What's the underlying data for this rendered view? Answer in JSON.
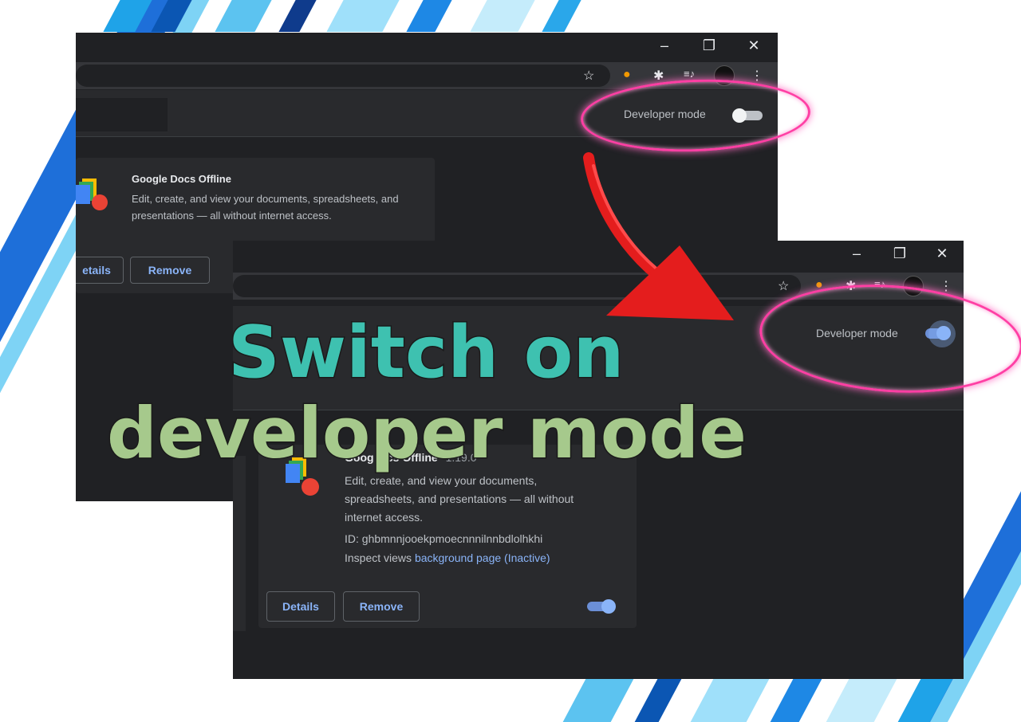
{
  "colors": {
    "dark_bg": "#202124",
    "toolbar": "#35363a",
    "link_blue": "#8ab4f8",
    "highlight_pink": "#ff3fa4",
    "arrow_red": "#e41d1d",
    "headline_teal": "#3ec1b0",
    "headline_green": "#a6c98c"
  },
  "window_controls": {
    "minimize": "–",
    "restore": "❐",
    "close": "✕"
  },
  "toolbar_icons": [
    "star-icon",
    "extension-icon",
    "puzzle-icon",
    "media-icon",
    "avatar",
    "menu-icon"
  ],
  "toolbar_glyphs": {
    "star": "☆",
    "puzzle": "✱",
    "media": "≡♪",
    "menu": "⋮"
  },
  "before": {
    "developer_mode_label": "Developer mode",
    "developer_mode_on": false,
    "extension": {
      "name": "Google Docs Offline",
      "description": "Edit, create, and view your documents, spreadsheets, and presentations — all without internet access."
    },
    "details_label": "etails",
    "remove_label": "Remove"
  },
  "after": {
    "developer_mode_label": "Developer mode",
    "developer_mode_on": true,
    "extension": {
      "name_part1": "Goog",
      "name_part2": "ocs Offline",
      "version": "1.19.0",
      "description": "Edit, create, and view your documents, spreadsheets, and presentations — all without internet access.",
      "id_text": "ID: ghbmnnjooekpmoecnnnilnnbdlolhkhi",
      "inspect_prefix": "Inspect views",
      "inspect_link": "background page (Inactive)",
      "enabled": true
    },
    "details_label": "Details",
    "remove_label": "Remove"
  },
  "headline": {
    "line1": "Switch on",
    "line2": "developer mode"
  }
}
